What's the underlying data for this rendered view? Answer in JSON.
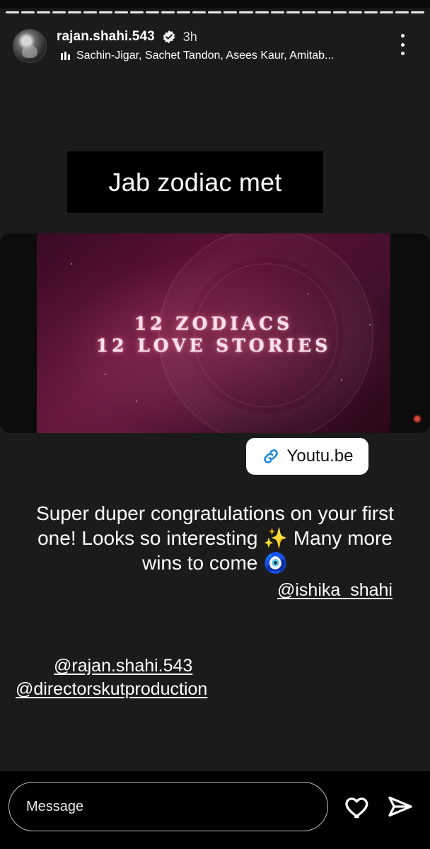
{
  "story": {
    "progress": {
      "segments": 27,
      "active_index": 26
    },
    "header": {
      "username": "rajan.shahi.543",
      "time": "3h",
      "music": "Sachin-Jigar, Sachet Tandon, Asees Kaur, Amitab...",
      "icons": [
        "verified-badge-icon",
        "more-options-icon",
        "music-bars-icon"
      ]
    },
    "title_sticker": {
      "text": "Jab zodiac met"
    },
    "media": {
      "line1": "12 ZODIACS",
      "line2": "12 LOVE STORIES"
    },
    "link_sticker": {
      "text": "Youtu.be",
      "icon": "link-icon"
    },
    "caption": {
      "text": "Super duper congratulations on your first one! Looks so interesting ✨ Many more wins to come 🧿"
    },
    "mentions": [
      "@ishika_shahi",
      "@rajan.shahi.543",
      "@directorskutproduction"
    ]
  },
  "reply_bar": {
    "placeholder": "Message",
    "icons": [
      "heart-icon",
      "send-icon"
    ]
  }
}
